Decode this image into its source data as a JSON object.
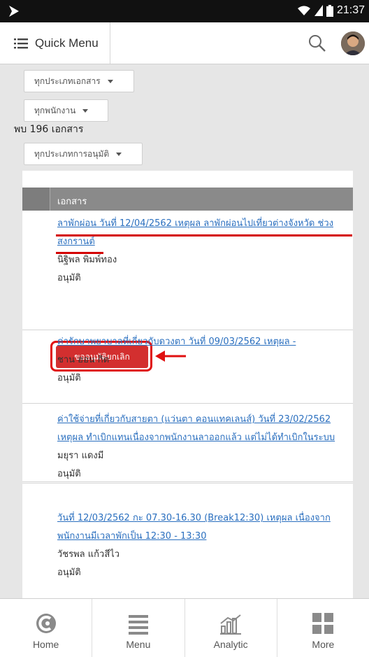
{
  "status_bar": {
    "time": "21:37"
  },
  "header": {
    "menu_title": "Quick Menu"
  },
  "filters": {
    "doc_type": "ทุกประเภทเอกสาร",
    "employee": "ทุกพนักงาน",
    "found": "พบ 196 เอกสาร",
    "approval_type": "ทุกประเภทการอนุมัติ"
  },
  "table": {
    "header": "เอกสาร",
    "rows": [
      {
        "title_line1": "ลาพักผ่อน วันที่ 12/04/2562 เหตุผล ลาพักผ่อนไปเที่ยวต่างจังหวัด ช่วง",
        "title_line2": "สงกรานต์",
        "person": "นิฐิพล พิมพ์ทอง",
        "status": "อนุมัติ",
        "action": "ขออนุมัติยกเลิก"
      },
      {
        "title_line1": "ค่ารักษาพยาบาลที่เกี่ยวกับดวงตา วันที่ 09/03/2562 เหตุผล -",
        "title_line2": "",
        "person": "ชาน ฮอน กิต",
        "status": "อนุมัติ"
      },
      {
        "title_line1": "ค่าใช้จ่ายที่เกี่ยวกับสายตา (แว่นตา คอนแทคเลนส์) วันที่ 23/02/2562",
        "title_line2": "เหตุผล ทำเบิกแทนเนื่องจากพนักงานลาออกแล้ว แต่ไม่ได้ทำเบิกในระบบ",
        "person": "มยุรา แดงมี",
        "status": "อนุมัติ"
      },
      {
        "title_line1": "วันที่ 12/03/2562 กะ 07.30-16.30 (Break12:30) เหตุผล เนื่องจาก",
        "title_line2": "พนักงานมีเวลาพักเป็น 12:30 - 13:30",
        "person": "วัชรพล แก้วสีไว",
        "status": "อนุมัติ"
      }
    ]
  },
  "bottom_nav": [
    {
      "label": "Home",
      "icon": "home-icon"
    },
    {
      "label": "Menu",
      "icon": "menu-icon"
    },
    {
      "label": "Analytic",
      "icon": "analytic-icon"
    },
    {
      "label": "More",
      "icon": "more-icon"
    }
  ],
  "colors": {
    "link": "#2a6fbf",
    "action": "#d32f2f",
    "highlight": "#e01010",
    "header_bg": "#8a8a8a"
  }
}
